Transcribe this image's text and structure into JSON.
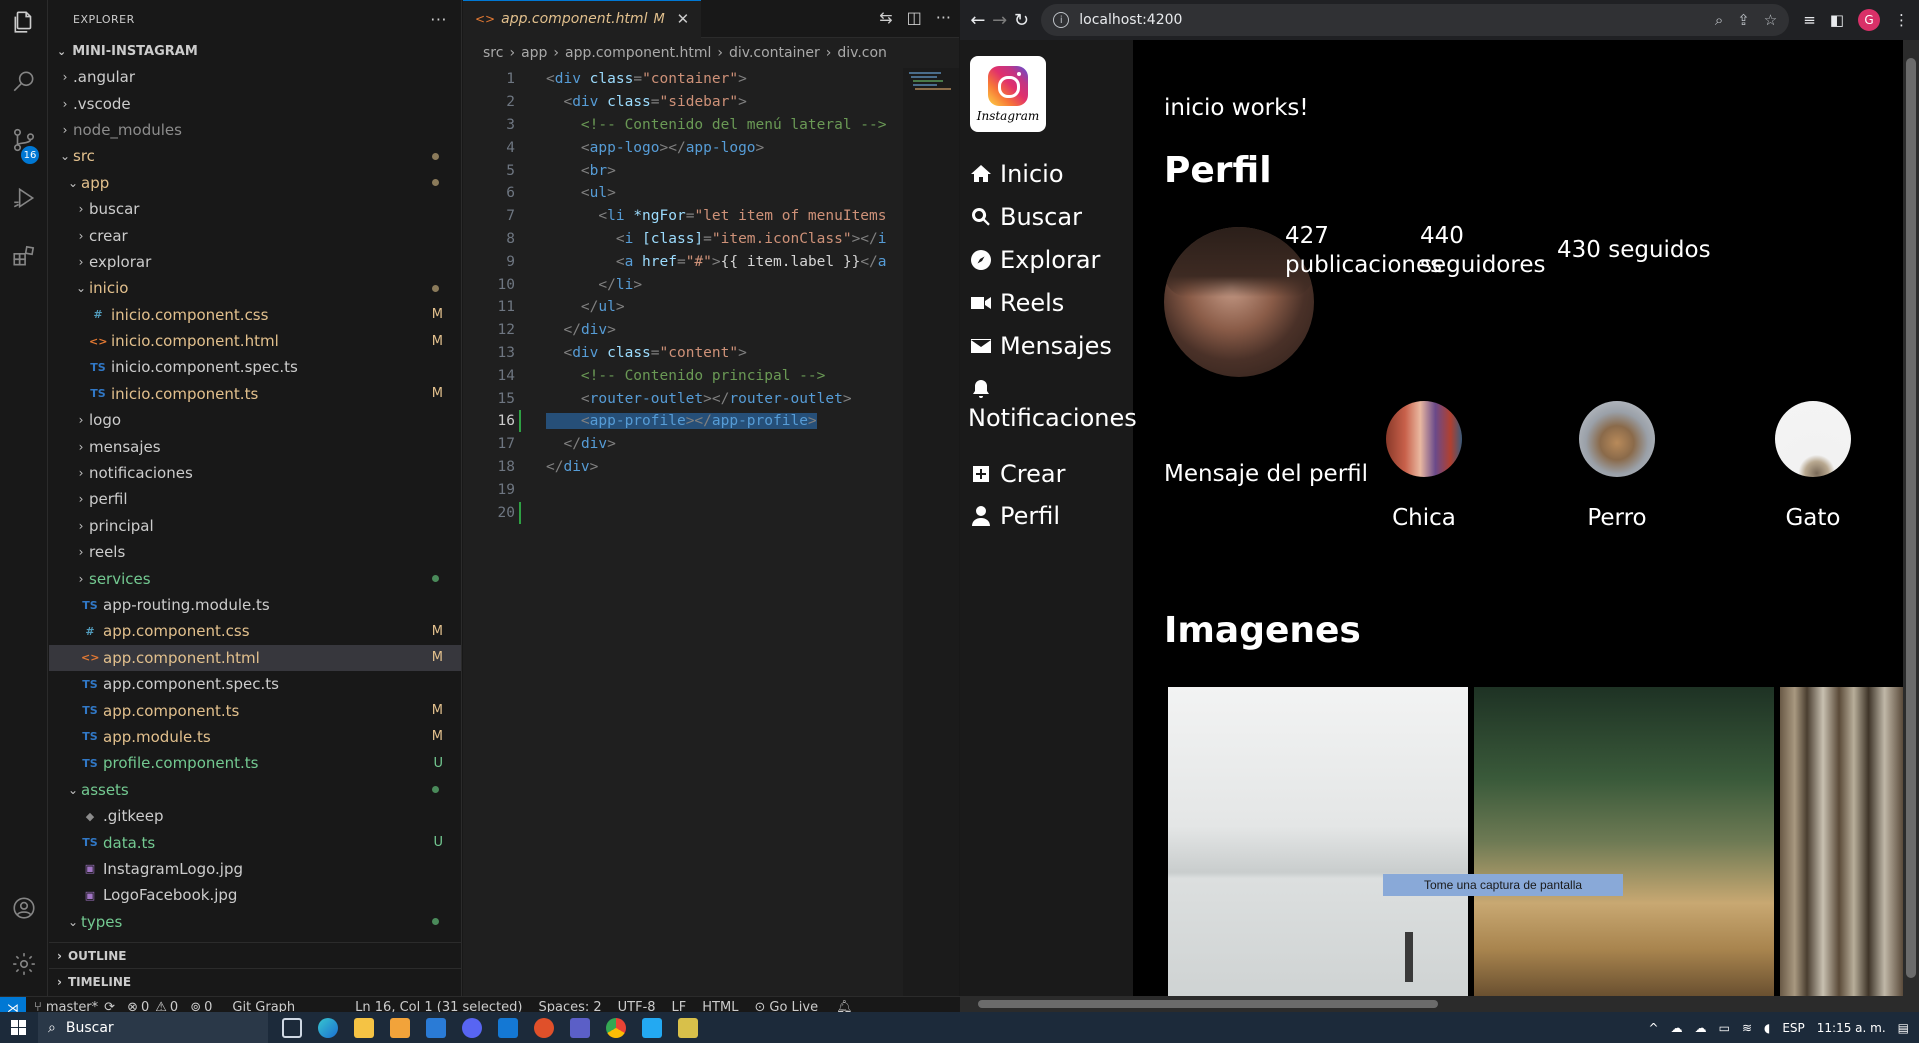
{
  "explorer": {
    "title": "EXPLORER",
    "more": "···",
    "project": "MINI-INSTAGRAM",
    "tree": [
      {
        "label": ".angular",
        "depth": 1,
        "kind": "folder",
        "open": false,
        "state": "plain"
      },
      {
        "label": ".vscode",
        "depth": 1,
        "kind": "folder",
        "open": false,
        "state": "plain"
      },
      {
        "label": "node_modules",
        "depth": 1,
        "kind": "folder",
        "open": false,
        "state": "dim"
      },
      {
        "label": "src",
        "depth": 1,
        "kind": "folder",
        "open": true,
        "state": "mod",
        "mark": "dot"
      },
      {
        "label": "app",
        "depth": 2,
        "kind": "folder",
        "open": true,
        "state": "mod",
        "mark": "dot"
      },
      {
        "label": "buscar",
        "depth": 3,
        "kind": "folder",
        "open": false,
        "state": "plain"
      },
      {
        "label": "crear",
        "depth": 3,
        "kind": "folder",
        "open": false,
        "state": "plain"
      },
      {
        "label": "explorar",
        "depth": 3,
        "kind": "folder",
        "open": false,
        "state": "plain"
      },
      {
        "label": "inicio",
        "depth": 3,
        "kind": "folder",
        "open": true,
        "state": "mod",
        "mark": "dot"
      },
      {
        "label": "inicio.component.css",
        "depth": 4,
        "kind": "css",
        "state": "mod",
        "mark": "M"
      },
      {
        "label": "inicio.component.html",
        "depth": 4,
        "kind": "html",
        "state": "mod",
        "mark": "M"
      },
      {
        "label": "inicio.component.spec.ts",
        "depth": 4,
        "kind": "ts",
        "state": "plain"
      },
      {
        "label": "inicio.component.ts",
        "depth": 4,
        "kind": "ts",
        "state": "mod",
        "mark": "M"
      },
      {
        "label": "logo",
        "depth": 3,
        "kind": "folder",
        "open": false,
        "state": "plain"
      },
      {
        "label": "mensajes",
        "depth": 3,
        "kind": "folder",
        "open": false,
        "state": "plain"
      },
      {
        "label": "notificaciones",
        "depth": 3,
        "kind": "folder",
        "open": false,
        "state": "plain"
      },
      {
        "label": "perfil",
        "depth": 3,
        "kind": "folder",
        "open": false,
        "state": "plain"
      },
      {
        "label": "principal",
        "depth": 3,
        "kind": "folder",
        "open": false,
        "state": "plain"
      },
      {
        "label": "reels",
        "depth": 3,
        "kind": "folder",
        "open": false,
        "state": "plain"
      },
      {
        "label": "services",
        "depth": 3,
        "kind": "folder",
        "open": false,
        "state": "new",
        "mark": "dot"
      },
      {
        "label": "app-routing.module.ts",
        "depth": 3,
        "kind": "ts",
        "state": "plain"
      },
      {
        "label": "app.component.css",
        "depth": 3,
        "kind": "css",
        "state": "mod",
        "mark": "M"
      },
      {
        "label": "app.component.html",
        "depth": 3,
        "kind": "html",
        "state": "mod",
        "mark": "M",
        "selected": true
      },
      {
        "label": "app.component.spec.ts",
        "depth": 3,
        "kind": "ts",
        "state": "plain"
      },
      {
        "label": "app.component.ts",
        "depth": 3,
        "kind": "ts",
        "state": "mod",
        "mark": "M"
      },
      {
        "label": "app.module.ts",
        "depth": 3,
        "kind": "ts",
        "state": "mod",
        "mark": "M"
      },
      {
        "label": "profile.component.ts",
        "depth": 3,
        "kind": "ts",
        "state": "new",
        "mark": "U"
      },
      {
        "label": "assets",
        "depth": 2,
        "kind": "folder",
        "open": true,
        "state": "new",
        "mark": "dot"
      },
      {
        "label": ".gitkeep",
        "depth": 3,
        "kind": "git",
        "state": "plain"
      },
      {
        "label": "data.ts",
        "depth": 3,
        "kind": "ts",
        "state": "new",
        "mark": "U"
      },
      {
        "label": "InstagramLogo.jpg",
        "depth": 3,
        "kind": "img",
        "state": "plain"
      },
      {
        "label": "LogoFacebook.jpg",
        "depth": 3,
        "kind": "img",
        "state": "plain"
      },
      {
        "label": "types",
        "depth": 2,
        "kind": "folder",
        "open": true,
        "state": "new",
        "mark": "dot"
      }
    ],
    "outline": "OUTLINE",
    "timeline": "TIMELINE"
  },
  "editor": {
    "tab_label": "app.component.html",
    "tab_mod": "M",
    "breadcrumb": [
      "src",
      "app",
      "app.component.html",
      "div.container",
      "div.con"
    ],
    "active_line": 16,
    "lines": [
      [
        [
          "t-pun",
          "<"
        ],
        [
          "t-tag",
          "div"
        ],
        [
          "t-attr",
          " class"
        ],
        [
          "t-pun",
          "="
        ],
        [
          "t-str",
          "\"container\""
        ],
        [
          "t-pun",
          ">"
        ]
      ],
      [
        [
          "t-txt",
          "  "
        ],
        [
          "t-pun",
          "<"
        ],
        [
          "t-tag",
          "div"
        ],
        [
          "t-attr",
          " class"
        ],
        [
          "t-pun",
          "="
        ],
        [
          "t-str",
          "\"sidebar\""
        ],
        [
          "t-pun",
          ">"
        ]
      ],
      [
        [
          "t-txt",
          "    "
        ],
        [
          "t-com",
          "<!-- Contenido del menú lateral -->"
        ]
      ],
      [
        [
          "t-txt",
          "    "
        ],
        [
          "t-pun",
          "<"
        ],
        [
          "t-tag",
          "app-logo"
        ],
        [
          "t-pun",
          "></"
        ],
        [
          "t-tag",
          "app-logo"
        ],
        [
          "t-pun",
          ">"
        ]
      ],
      [
        [
          "t-txt",
          "    "
        ],
        [
          "t-pun",
          "<"
        ],
        [
          "t-tag",
          "br"
        ],
        [
          "t-pun",
          ">"
        ]
      ],
      [
        [
          "t-txt",
          "    "
        ],
        [
          "t-pun",
          "<"
        ],
        [
          "t-tag",
          "ul"
        ],
        [
          "t-pun",
          ">"
        ]
      ],
      [
        [
          "t-txt",
          "      "
        ],
        [
          "t-pun",
          "<"
        ],
        [
          "t-tag",
          "li"
        ],
        [
          "t-attr",
          " *ngFor"
        ],
        [
          "t-pun",
          "="
        ],
        [
          "t-str",
          "\"let item of menuItems"
        ]
      ],
      [
        [
          "t-txt",
          "        "
        ],
        [
          "t-pun",
          "<"
        ],
        [
          "t-tag",
          "i"
        ],
        [
          "t-attr",
          " [class]"
        ],
        [
          "t-pun",
          "="
        ],
        [
          "t-str",
          "\"item.iconClass\""
        ],
        [
          "t-pun",
          "></"
        ],
        [
          "t-tag",
          "i"
        ]
      ],
      [
        [
          "t-txt",
          "        "
        ],
        [
          "t-pun",
          "<"
        ],
        [
          "t-tag",
          "a"
        ],
        [
          "t-attr",
          " href"
        ],
        [
          "t-pun",
          "="
        ],
        [
          "t-str",
          "\"#\""
        ],
        [
          "t-pun",
          ">"
        ],
        [
          "t-txt",
          "{{ item.label }}"
        ],
        [
          "t-pun",
          "</"
        ],
        [
          "t-tag",
          "a"
        ]
      ],
      [
        [
          "t-txt",
          "      "
        ],
        [
          "t-pun",
          "</"
        ],
        [
          "t-tag",
          "li"
        ],
        [
          "t-pun",
          ">"
        ]
      ],
      [
        [
          "t-txt",
          "    "
        ],
        [
          "t-pun",
          "</"
        ],
        [
          "t-tag",
          "ul"
        ],
        [
          "t-pun",
          ">"
        ]
      ],
      [
        [
          "t-txt",
          "  "
        ],
        [
          "t-pun",
          "</"
        ],
        [
          "t-tag",
          "div"
        ],
        [
          "t-pun",
          ">"
        ]
      ],
      [
        [
          "t-txt",
          "  "
        ],
        [
          "t-pun",
          "<"
        ],
        [
          "t-tag",
          "div"
        ],
        [
          "t-attr",
          " class"
        ],
        [
          "t-pun",
          "="
        ],
        [
          "t-str",
          "\"content\""
        ],
        [
          "t-pun",
          ">"
        ]
      ],
      [
        [
          "t-txt",
          "    "
        ],
        [
          "t-com",
          "<!-- Contenido principal -->"
        ]
      ],
      [
        [
          "t-txt",
          "    "
        ],
        [
          "t-pun",
          "<"
        ],
        [
          "t-tag",
          "router-outlet"
        ],
        [
          "t-pun",
          "></"
        ],
        [
          "t-tag",
          "router-outlet"
        ],
        [
          "t-pun",
          ">"
        ]
      ],
      [
        [
          "t-txt",
          "    "
        ],
        [
          "t-pun",
          "<"
        ],
        [
          "t-tag",
          "app-profile"
        ],
        [
          "t-pun",
          "></"
        ],
        [
          "t-tag",
          "app-profile"
        ],
        [
          "t-pun",
          ">"
        ]
      ],
      [
        [
          "t-txt",
          "  "
        ],
        [
          "t-pun",
          "</"
        ],
        [
          "t-tag",
          "div"
        ],
        [
          "t-pun",
          ">"
        ]
      ],
      [
        [
          "t-pun",
          "</"
        ],
        [
          "t-tag",
          "div"
        ],
        [
          "t-pun",
          ">"
        ]
      ],
      [],
      []
    ]
  },
  "browser": {
    "url": "localhost:4200",
    "profile_initial": "G",
    "sidebar_menu": [
      {
        "label": "Inicio",
        "icon": "home-icon"
      },
      {
        "label": "Buscar",
        "icon": "search-icon"
      },
      {
        "label": "Explorar",
        "icon": "compass-icon"
      },
      {
        "label": "Reels",
        "icon": "video-icon"
      },
      {
        "label": "Mensajes",
        "icon": "envelope-icon"
      },
      {
        "label": "Notificaciones",
        "icon": "bell-icon"
      },
      {
        "label": "Crear",
        "icon": "plus-square-icon"
      },
      {
        "label": "Perfil",
        "icon": "user-icon"
      }
    ],
    "logo_text": "Instagram",
    "works_text": "inicio works!",
    "perfil_heading": "Perfil",
    "stats": {
      "posts_count": "427",
      "posts_label": "publicaciones",
      "followers_count": "440",
      "followers_label": "seguidores",
      "following": "430 seguidos"
    },
    "profile_message": "Mensaje del perfil",
    "stories": [
      "Chica",
      "Perro",
      "Gato"
    ],
    "images_heading": "Imagenes",
    "toast": "Tome una captura de pantalla"
  },
  "statusbar": {
    "branch": "master*",
    "errors": "0",
    "warnings": "0",
    "ports": "0",
    "git_graph": "Git Graph",
    "cursor": "Ln 16, Col 1 (31 selected)",
    "spaces": "Spaces: 2",
    "encoding": "UTF-8",
    "eol": "LF",
    "language": "HTML",
    "golive": "Go Live"
  },
  "taskbar": {
    "search": "Buscar",
    "lang": "ESP",
    "time": "11:15 a. m."
  },
  "colors": {
    "accent": "#0078d4",
    "modified": "#e2c08d",
    "untracked": "#73c991"
  }
}
